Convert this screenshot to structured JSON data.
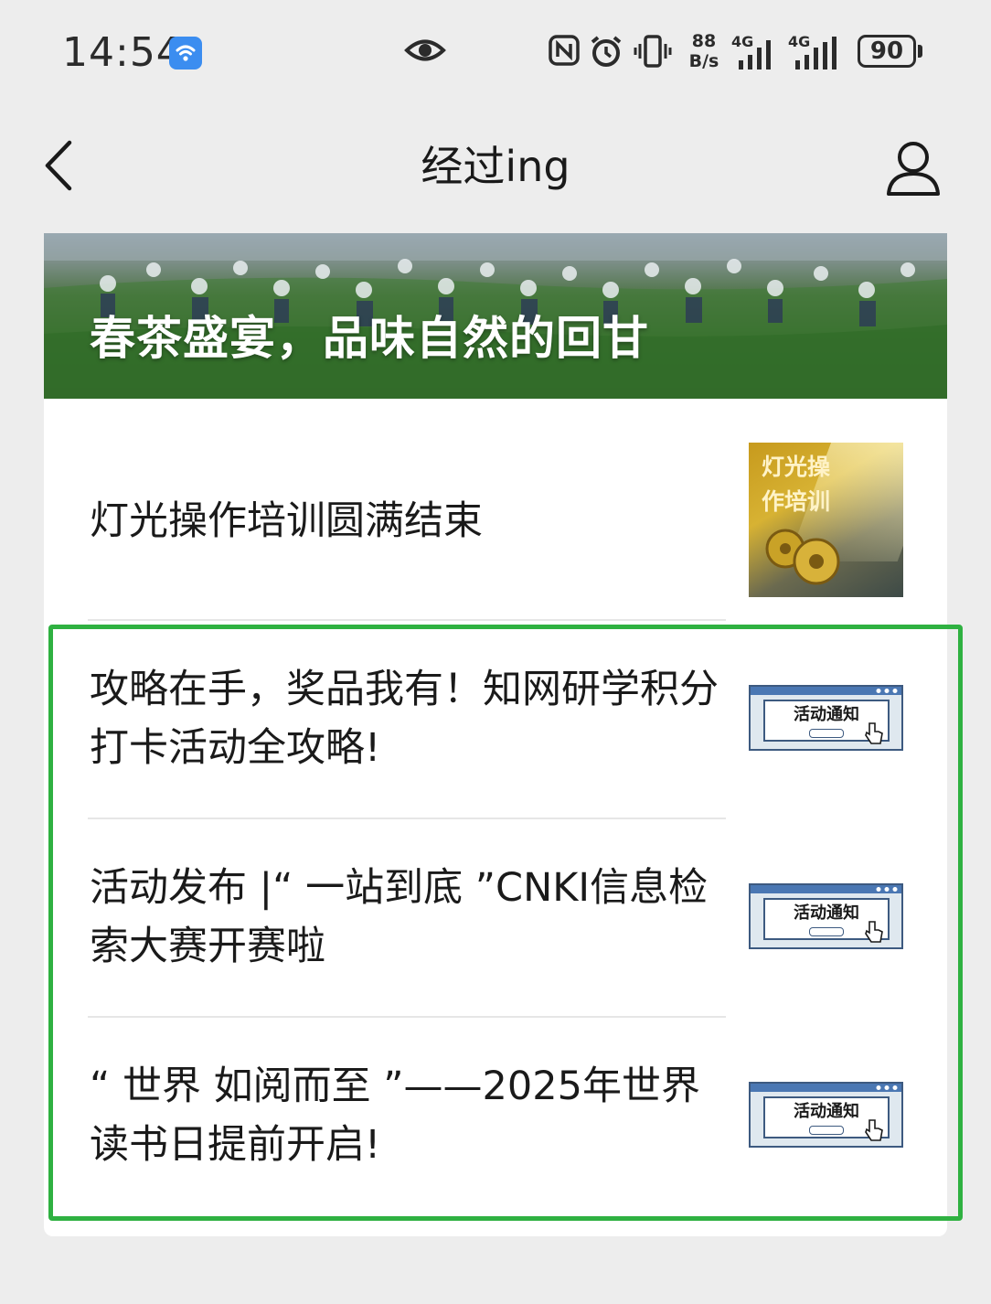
{
  "status_bar": {
    "time": "14:54",
    "net_speed_value": "88",
    "net_speed_unit": "B/s",
    "signal_1_label": "4G",
    "signal_2_label": "4G",
    "battery": "90",
    "icons": [
      "wifi-hotspot-icon",
      "eye-icon",
      "nfc-icon",
      "alarm-icon",
      "vibrate-icon",
      "signal-icon",
      "battery-icon"
    ]
  },
  "nav": {
    "title": "经过ing",
    "back_icon": "chevron-left-icon",
    "profile_icon": "user-icon"
  },
  "cover": {
    "title": "春茶盛宴，品味自然的回甘"
  },
  "articles": [
    {
      "title": "灯光操作培训圆满结束",
      "thumb_line1": "灯光操",
      "thumb_line2": "作培训"
    },
    {
      "title": "攻略在手，奖品我有！知网研学积分打卡活动全攻略!",
      "thumb_text": "活动通知"
    },
    {
      "title": "活动发布 |“ 一站到底 ”CNKI信息检索大赛开赛啦",
      "thumb_text": "活动通知"
    },
    {
      "title": "“ 世界 如阅而至 ”——2025年世界读书日提前开启!",
      "thumb_text": "活动通知"
    }
  ],
  "colors": {
    "highlight": "#2fb141",
    "background": "#ededed",
    "card": "#ffffff",
    "notice_blue": "#4a77b3"
  }
}
